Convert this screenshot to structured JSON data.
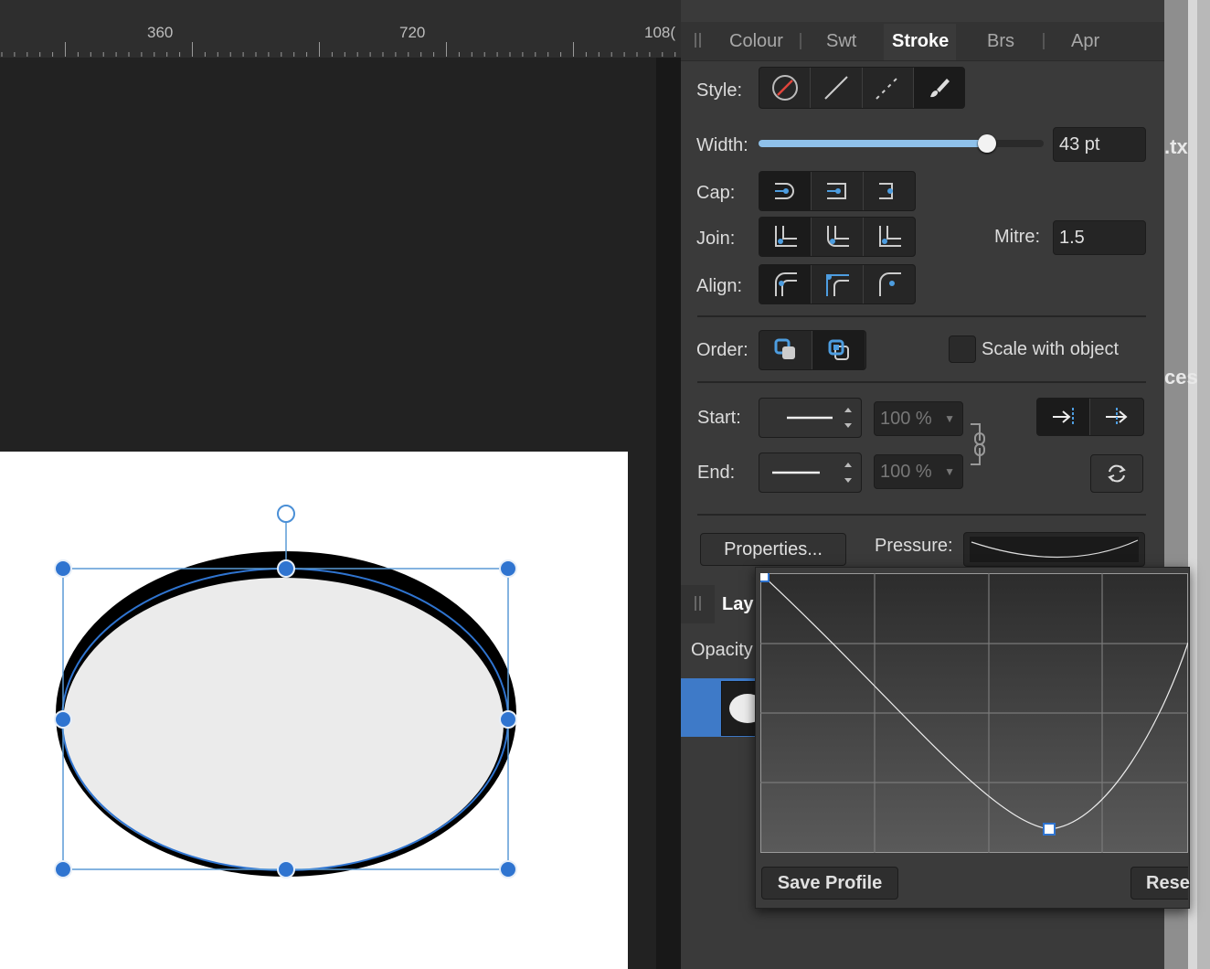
{
  "ruler": {
    "marks": [
      "360",
      "720",
      "108("
    ]
  },
  "edge": {
    "top_text": ".tx",
    "mid_text": "ces"
  },
  "panel": {
    "tabs": [
      {
        "label": "Colour",
        "active": false
      },
      {
        "label": "Swt",
        "active": false
      },
      {
        "label": "Stroke",
        "active": true
      },
      {
        "label": "Brs",
        "active": false
      },
      {
        "label": "Apr",
        "active": false
      }
    ],
    "style_label": "Style:",
    "width_label": "Width:",
    "width_value": "43 pt",
    "width_fraction": 0.8,
    "cap_label": "Cap:",
    "join_label": "Join:",
    "mitre_label": "Mitre:",
    "mitre_value": "1.5",
    "align_label": "Align:",
    "order_label": "Order:",
    "scale_label": "Scale with object",
    "start_label": "Start:",
    "end_label": "End:",
    "start_scale": "100 %",
    "end_scale": "100 %",
    "properties_button": "Properties...",
    "pressure_label": "Pressure:"
  },
  "layers": {
    "tab_label": "Lay",
    "opacity_label": "Opacity"
  },
  "popup": {
    "save_button": "Save Profile",
    "reset_button": "Rese"
  },
  "colors": {
    "accent": "#3e7ac8",
    "selection": "#2f74d0",
    "slider_fill": "#8fc1ea"
  },
  "icons": [
    "no-stroke-icon",
    "solid-line-icon",
    "dashed-line-icon",
    "brush-icon",
    "butt-cap-icon",
    "round-cap-icon",
    "square-cap-icon",
    "miter-join-icon",
    "round-join-icon",
    "bevel-join-icon",
    "align-center-icon",
    "align-inside-icon",
    "align-outside-icon",
    "stroke-behind-fill-icon",
    "stroke-in-front-icon",
    "chain-link-icon",
    "arrow-beyond-icon",
    "arrow-at-end-icon",
    "swap-arrows-icon"
  ]
}
